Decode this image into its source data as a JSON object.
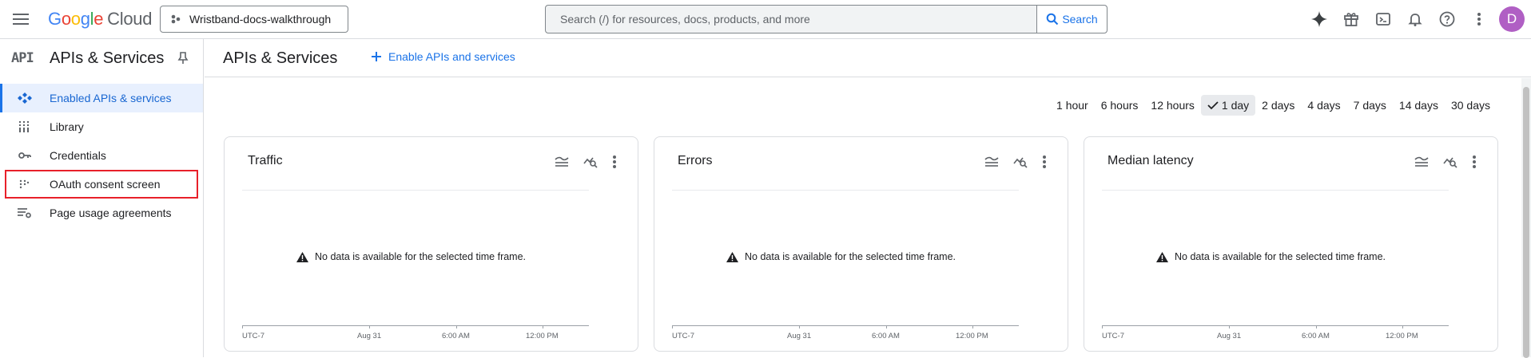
{
  "header": {
    "logo": {
      "google": "Google",
      "cloud": "Cloud"
    },
    "project": "Wristband-docs-walkthrough",
    "search_placeholder": "Search (/) for resources, docs, products, and more",
    "search_button": "Search",
    "avatar_letter": "D",
    "icons": [
      "gemini-sparkle-icon",
      "gift-icon",
      "cloud-shell-icon",
      "notifications-icon",
      "help-icon",
      "more-vert-icon"
    ]
  },
  "sidebar": {
    "logo_text": "API",
    "title": "APIs & Services",
    "items": [
      {
        "label": "Enabled APIs & services",
        "icon": "enabled-apis-icon",
        "active": true
      },
      {
        "label": "Library",
        "icon": "library-icon"
      },
      {
        "label": "Credentials",
        "icon": "key-icon"
      },
      {
        "label": "OAuth consent screen",
        "icon": "oauth-dots-icon",
        "highlighted": true
      },
      {
        "label": "Page usage agreements",
        "icon": "settings-list-icon"
      }
    ]
  },
  "main": {
    "title": "APIs & Services",
    "enable_button": "Enable APIs and services",
    "time_ranges": [
      "1 hour",
      "6 hours",
      "12 hours",
      "1 day",
      "2 days",
      "4 days",
      "7 days",
      "14 days",
      "30 days"
    ],
    "selected_time_range": "1 day",
    "cards": [
      {
        "title": "Traffic",
        "no_data": "No data is available for the selected time frame.",
        "x_labels": [
          "UTC-7",
          "Aug 31",
          "6:00 AM",
          "12:00 PM"
        ]
      },
      {
        "title": "Errors",
        "no_data": "No data is available for the selected time frame.",
        "x_labels": [
          "UTC-7",
          "Aug 31",
          "6:00 AM",
          "12:00 PM"
        ]
      },
      {
        "title": "Median latency",
        "no_data": "No data is available for the selected time frame.",
        "x_labels": [
          "UTC-7",
          "Aug 31",
          "6:00 AM",
          "12:00 PM"
        ]
      }
    ]
  },
  "colors": {
    "accent": "#1a73e8",
    "active_bg": "#e8f0fe",
    "highlight_border": "#e8202a",
    "avatar": "#b05fc4"
  }
}
